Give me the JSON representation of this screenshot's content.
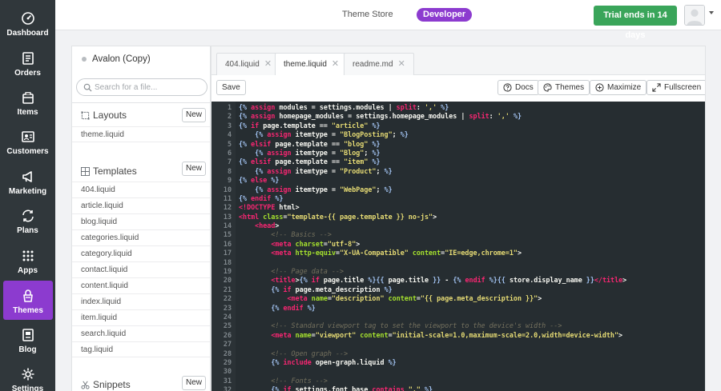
{
  "nav": [
    {
      "label": "Dashboard",
      "icon": "dashboard-icon"
    },
    {
      "label": "Orders",
      "icon": "orders-icon"
    },
    {
      "label": "Items",
      "icon": "items-icon"
    },
    {
      "label": "Customers",
      "icon": "customers-icon"
    },
    {
      "label": "Marketing",
      "icon": "marketing-icon"
    },
    {
      "label": "Plans",
      "icon": "plans-icon"
    },
    {
      "label": "Apps",
      "icon": "apps-icon"
    },
    {
      "label": "Themes",
      "icon": "themes-icon",
      "active": true
    },
    {
      "label": "Blog",
      "icon": "blog-icon"
    },
    {
      "label": "Settings",
      "icon": "settings-icon"
    }
  ],
  "topbar": {
    "store_label": "Theme Store",
    "badge": "Developer",
    "trial_button": "Trial ends in 14 days"
  },
  "files": {
    "theme_name": "Avalon (Copy)",
    "search_placeholder": "Search for a file...",
    "new_label": "New",
    "layouts_title": "Layouts",
    "layouts": [
      "theme.liquid"
    ],
    "templates_title": "Templates",
    "templates": [
      "404.liquid",
      "article.liquid",
      "blog.liquid",
      "categories.liquid",
      "category.liquid",
      "contact.liquid",
      "content.liquid",
      "index.liquid",
      "item.liquid",
      "search.liquid",
      "tag.liquid"
    ],
    "snippets_title": "Snippets"
  },
  "editor": {
    "tabs": [
      "404.liquid",
      "theme.liquid",
      "readme.md"
    ],
    "active_tab": "theme.liquid",
    "save_label": "Save",
    "docs_label": "Docs",
    "themes_label": "Themes",
    "maximize_label": "Maximize",
    "fullscreen_label": "Fullscreen",
    "code_lines": [
      "{% assign modules = settings.modules | split: ',' %}",
      "{% assign homepage_modules = settings.homepage_modules | split: ',' %}",
      "{% if page.template == \"article\" %}",
      "    {% assign itemtype = \"BlogPosting\"; %}",
      "{% elsif page.template == \"blog\" %}",
      "    {% assign itemtype = \"Blog\"; %}",
      "{% elsif page.template == \"item\" %}",
      "    {% assign itemtype = \"Product\"; %}",
      "{% else %}",
      "    {% assign itemtype = \"WebPage\"; %}",
      "{% endif %}",
      "<!DOCTYPE html>",
      "<html class=\"template-{{ page.template }} no-js\">",
      "    <head>",
      "        <!-- Basics -->",
      "        <meta charset=\"utf-8\">",
      "        <meta http-equiv=\"X-UA-Compatible\" content=\"IE=edge,chrome=1\">",
      "",
      "        <!-- Page data -->",
      "        <title>{% if page.title %}{{ page.title }} - {% endif %}{{ store.display_name }}</title>",
      "        {% if page.meta_description %}",
      "            <meta name=\"description\" content=\"{{ page.meta_description }}\">",
      "        {% endif %}",
      "",
      "        <!-- Standard viewport tag to set the viewport to the device's width -->",
      "        <meta name=\"viewport\" content=\"initial-scale=1.0,maximum-scale=2.0,width=device-width\">",
      "",
      "        <!-- Open graph -->",
      "        {% include open-graph.liquid %}",
      "",
      "        <!-- Fonts -->",
      "        {% if settings.font_base contains \",\" %}"
    ]
  }
}
